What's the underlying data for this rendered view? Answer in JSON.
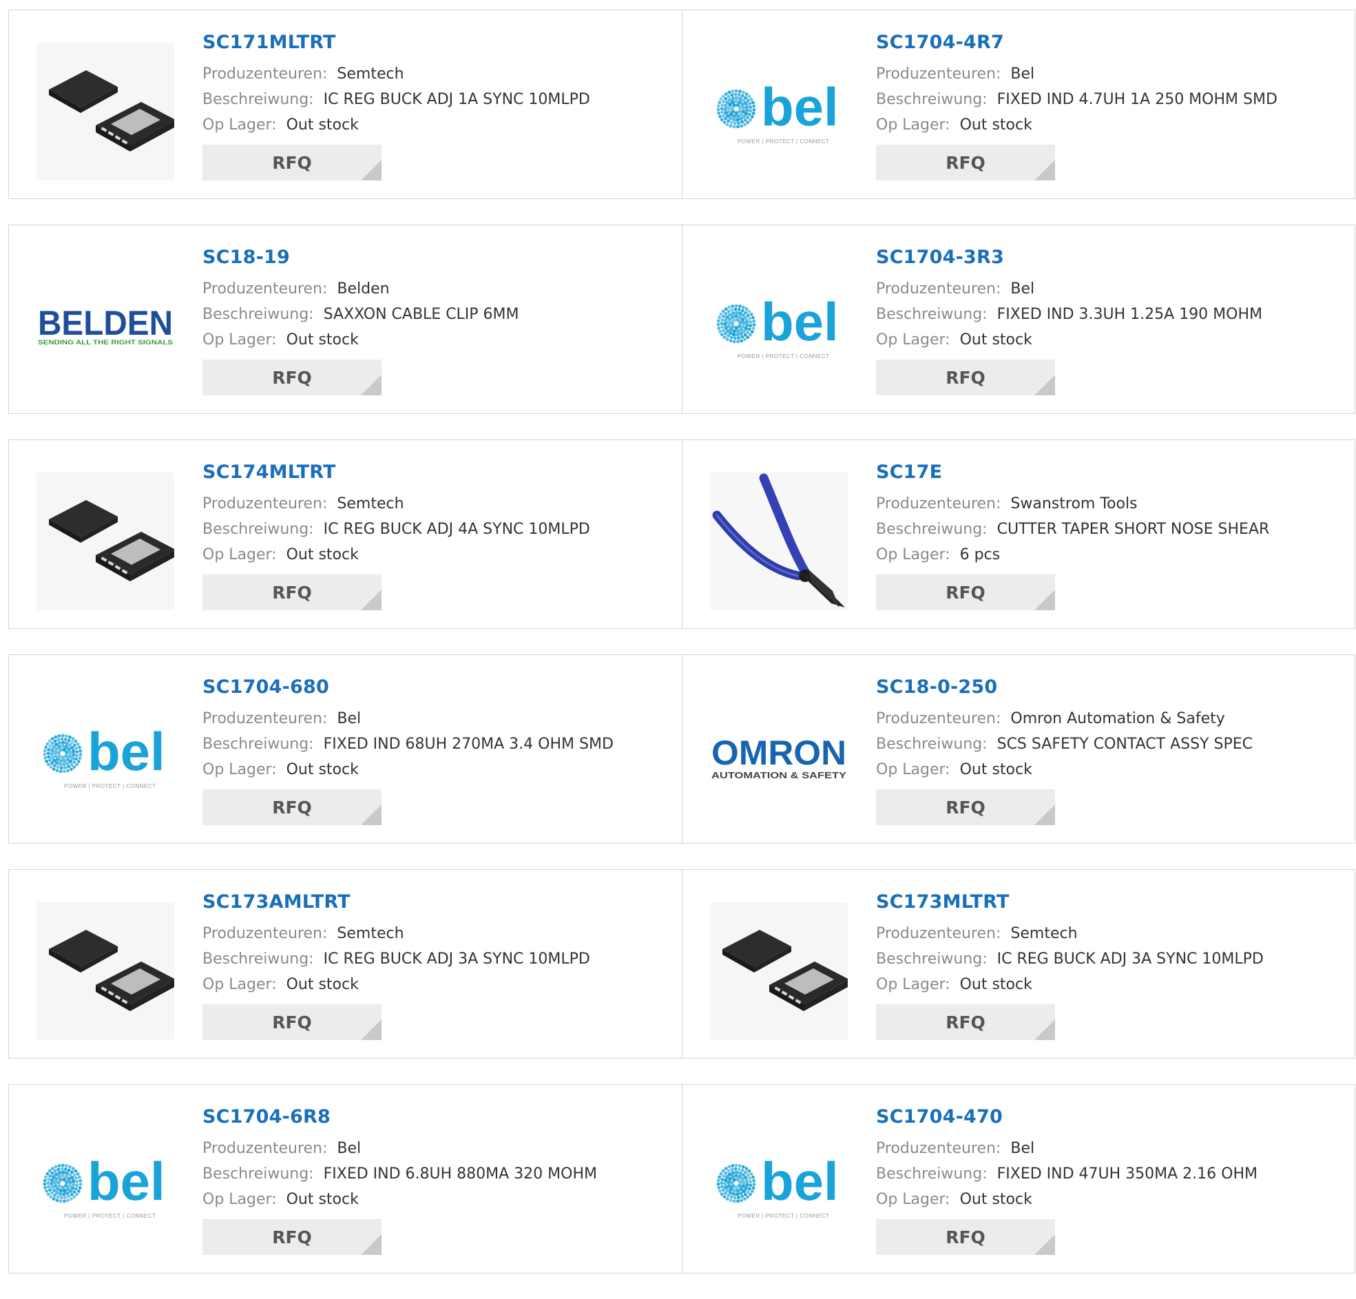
{
  "labels": {
    "manufacturer": "Produzenteuren:",
    "description": "Beschreiwung:",
    "stock": "Op Lager:",
    "rfq": "RFQ"
  },
  "logos": {
    "bel_text": "bel",
    "bel_tagline": "POWER | PROTECT | CONNECT",
    "belden_text": "BELDEN",
    "belden_tagline": "SENDING ALL THE RIGHT SIGNALS",
    "omron_text": "OMRON",
    "omron_tagline": "AUTOMATION & SAFETY"
  },
  "colors": {
    "link": "#1a6fba",
    "bel_blue": "#1aa3d8",
    "belden_blue": "#1f4e9c",
    "belden_green": "#3a9a3a",
    "omron_blue": "#1864b0"
  },
  "products": [
    {
      "part": "SC171MLTRT",
      "manufacturer": "Semtech",
      "description": "IC REG BUCK ADJ 1A SYNC 10MLPD",
      "stock": "Out stock",
      "image": "chip-icon"
    },
    {
      "part": "SC1704-4R7",
      "manufacturer": "Bel",
      "description": "FIXED IND 4.7UH 1A 250 MOHM SMD",
      "stock": "Out stock",
      "image": "bel-logo"
    },
    {
      "part": "SC18-19",
      "manufacturer": "Belden",
      "description": "SAXXON CABLE CLIP 6MM",
      "stock": "Out stock",
      "image": "belden-logo"
    },
    {
      "part": "SC1704-3R3",
      "manufacturer": "Bel",
      "description": "FIXED IND 3.3UH 1.25A 190 MOHM",
      "stock": "Out stock",
      "image": "bel-logo"
    },
    {
      "part": "SC174MLTRT",
      "manufacturer": "Semtech",
      "description": "IC REG BUCK ADJ 4A SYNC 10MLPD",
      "stock": "Out stock",
      "image": "chip-icon"
    },
    {
      "part": "SC17E",
      "manufacturer": "Swanstrom Tools",
      "description": "CUTTER TAPER SHORT NOSE SHEAR",
      "stock": "6 pcs",
      "image": "cutter-icon"
    },
    {
      "part": "SC1704-680",
      "manufacturer": "Bel",
      "description": "FIXED IND 68UH 270MA 3.4 OHM SMD",
      "stock": "Out stock",
      "image": "bel-logo"
    },
    {
      "part": "SC18-0-250",
      "manufacturer": "Omron Automation & Safety",
      "description": "SCS SAFETY CONTACT ASSY SPEC",
      "stock": "Out stock",
      "image": "omron-logo"
    },
    {
      "part": "SC173AMLTRT",
      "manufacturer": "Semtech",
      "description": "IC REG BUCK ADJ 3A SYNC 10MLPD",
      "stock": "Out stock",
      "image": "chip-icon"
    },
    {
      "part": "SC173MLTRT",
      "manufacturer": "Semtech",
      "description": "IC REG BUCK ADJ 3A SYNC 10MLPD",
      "stock": "Out stock",
      "image": "chip-icon"
    },
    {
      "part": "SC1704-6R8",
      "manufacturer": "Bel",
      "description": "FIXED IND 6.8UH 880MA 320 MOHM",
      "stock": "Out stock",
      "image": "bel-logo"
    },
    {
      "part": "SC1704-470",
      "manufacturer": "Bel",
      "description": "FIXED IND 47UH 350MA 2.16 OHM",
      "stock": "Out stock",
      "image": "bel-logo"
    }
  ]
}
